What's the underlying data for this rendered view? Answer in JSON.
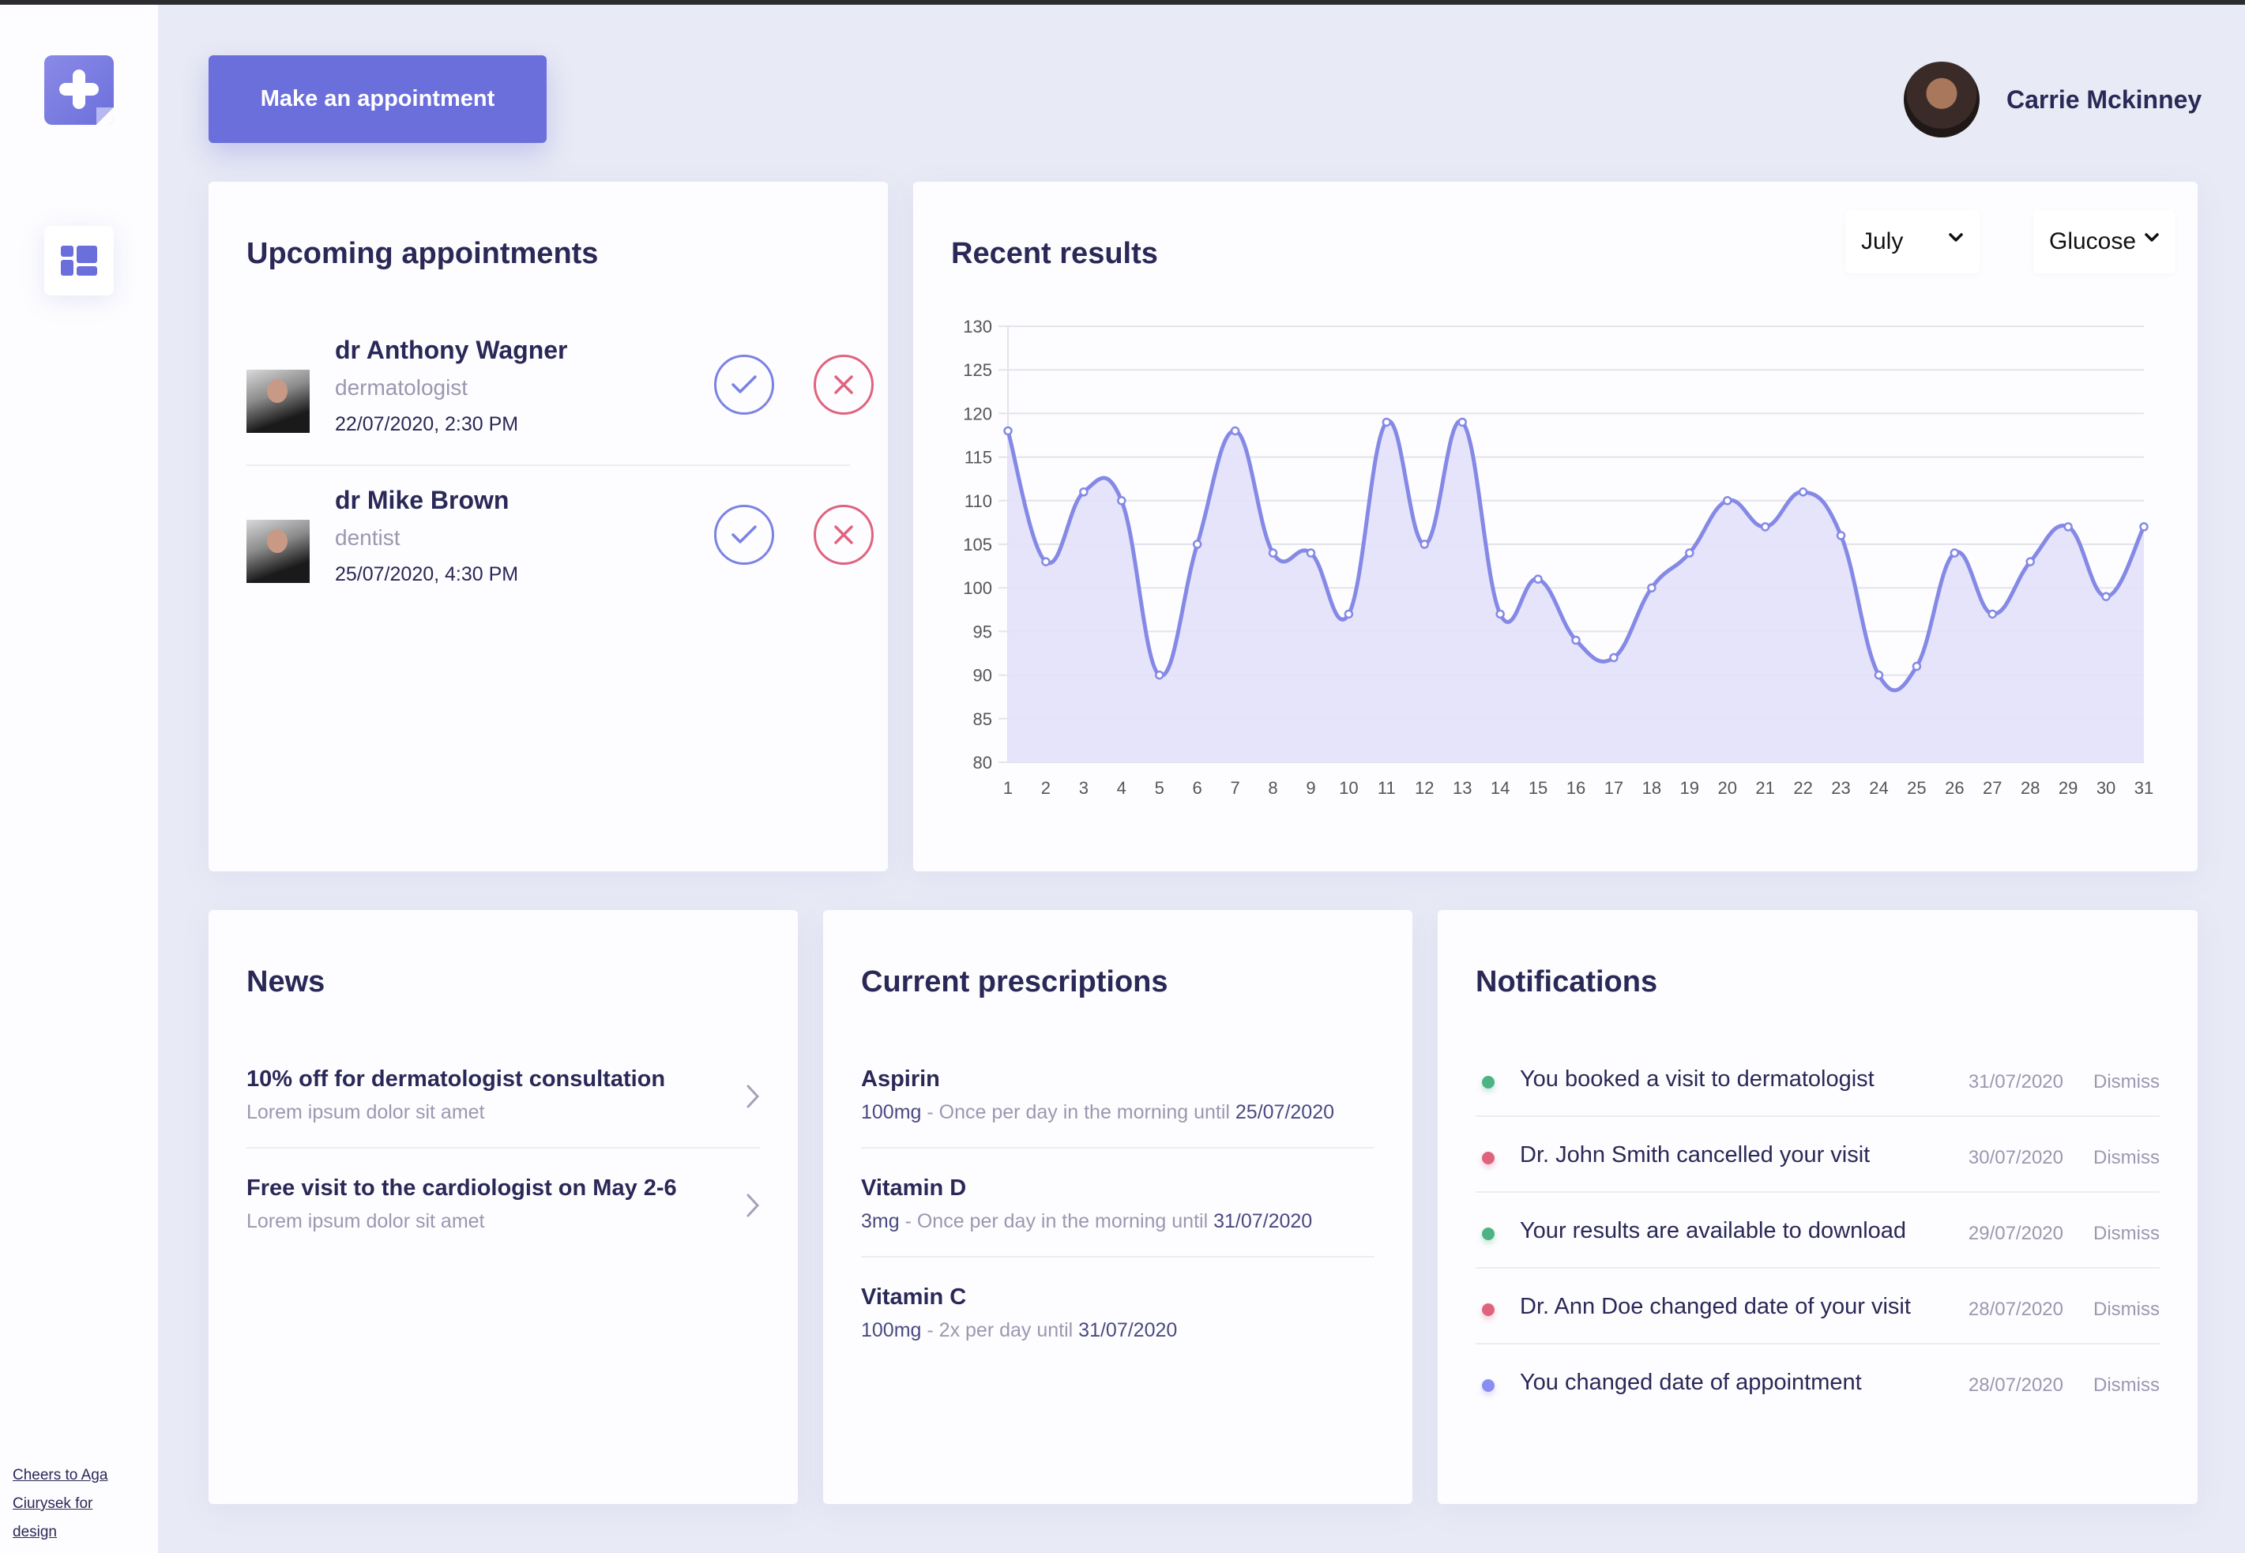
{
  "sidebar": {
    "logo_icon": "medical-cross-icon",
    "nav_icon": "dashboard-icon",
    "credit_lines": [
      "Cheers to Aga",
      "Ciurysek for",
      "design"
    ]
  },
  "header": {
    "appointment_button": "Make an appointment",
    "user_name": "Carrie Mckinney"
  },
  "upcoming": {
    "title": "Upcoming appointments",
    "items": [
      {
        "name": "dr Anthony Wagner",
        "specialty": "dermatologist",
        "datetime": "22/07/2020, 2:30 PM"
      },
      {
        "name": "dr Mike Brown",
        "specialty": "dentist",
        "datetime": "25/07/2020, 4:30 PM"
      }
    ],
    "accept_icon": "check-icon",
    "decline_icon": "close-icon",
    "colors": {
      "accept": "#7b82e3",
      "decline": "#e0637e"
    }
  },
  "results": {
    "title": "Recent results",
    "month_select": "July",
    "metric_select": "Glucose"
  },
  "chart_data": {
    "type": "area",
    "title": "Recent results",
    "xlabel": "",
    "ylabel": "",
    "x": [
      1,
      2,
      3,
      4,
      5,
      6,
      7,
      8,
      9,
      10,
      11,
      12,
      13,
      14,
      15,
      16,
      17,
      18,
      19,
      20,
      21,
      22,
      23,
      24,
      25,
      26,
      27,
      28,
      29,
      30,
      31
    ],
    "series": [
      {
        "name": "Glucose",
        "values": [
          118,
          103,
          111,
          110,
          90,
          105,
          118,
          104,
          104,
          97,
          119,
          105,
          119,
          97,
          101,
          94,
          92,
          100,
          104,
          110,
          107,
          111,
          106,
          90,
          91,
          104,
          97,
          103,
          107,
          99,
          107
        ]
      }
    ],
    "ylim": [
      80,
      130
    ],
    "yticks": [
      130,
      125,
      120,
      115,
      110,
      105,
      100,
      95,
      90,
      85,
      80
    ],
    "grid": true,
    "legend": "none",
    "colors": {
      "line": "#8589e6",
      "fill": "#e3e1f9"
    }
  },
  "news": {
    "title": "News",
    "items": [
      {
        "title": "10% off for dermatologist consultation",
        "subtitle": "Lorem ipsum dolor sit amet"
      },
      {
        "title": "Free visit to the cardiologist on May 2-6",
        "subtitle": "Lorem ipsum dolor sit amet"
      }
    ]
  },
  "prescriptions": {
    "title": "Current prescriptions",
    "items": [
      {
        "name": "Aspirin",
        "dose": "100mg",
        "schedule": " - Once per day in the morning until ",
        "until": "25/07/2020"
      },
      {
        "name": "Vitamin D",
        "dose": "3mg",
        "schedule": " - Once per day in the morning until ",
        "until": "31/07/2020"
      },
      {
        "name": "Vitamin C",
        "dose": "100mg",
        "schedule": " - 2x per day until ",
        "until": "31/07/2020"
      }
    ]
  },
  "notifications": {
    "title": "Notifications",
    "dismiss_label": "Dismiss",
    "items": [
      {
        "text": "You booked a visit to dermatologist",
        "date": "31/07/2020",
        "status": "success",
        "color": "#4fb283"
      },
      {
        "text": "Dr. John Smith cancelled your visit",
        "date": "30/07/2020",
        "status": "danger",
        "color": "#e0637e"
      },
      {
        "text": "Your results are available to download",
        "date": "29/07/2020",
        "status": "success",
        "color": "#4fb283"
      },
      {
        "text": "Dr. Ann Doe changed date of your visit",
        "date": "28/07/2020",
        "status": "danger",
        "color": "#e0637e"
      },
      {
        "text": "You changed date of appointment",
        "date": "28/07/2020",
        "status": "info",
        "color": "#8a8ef0"
      }
    ]
  }
}
